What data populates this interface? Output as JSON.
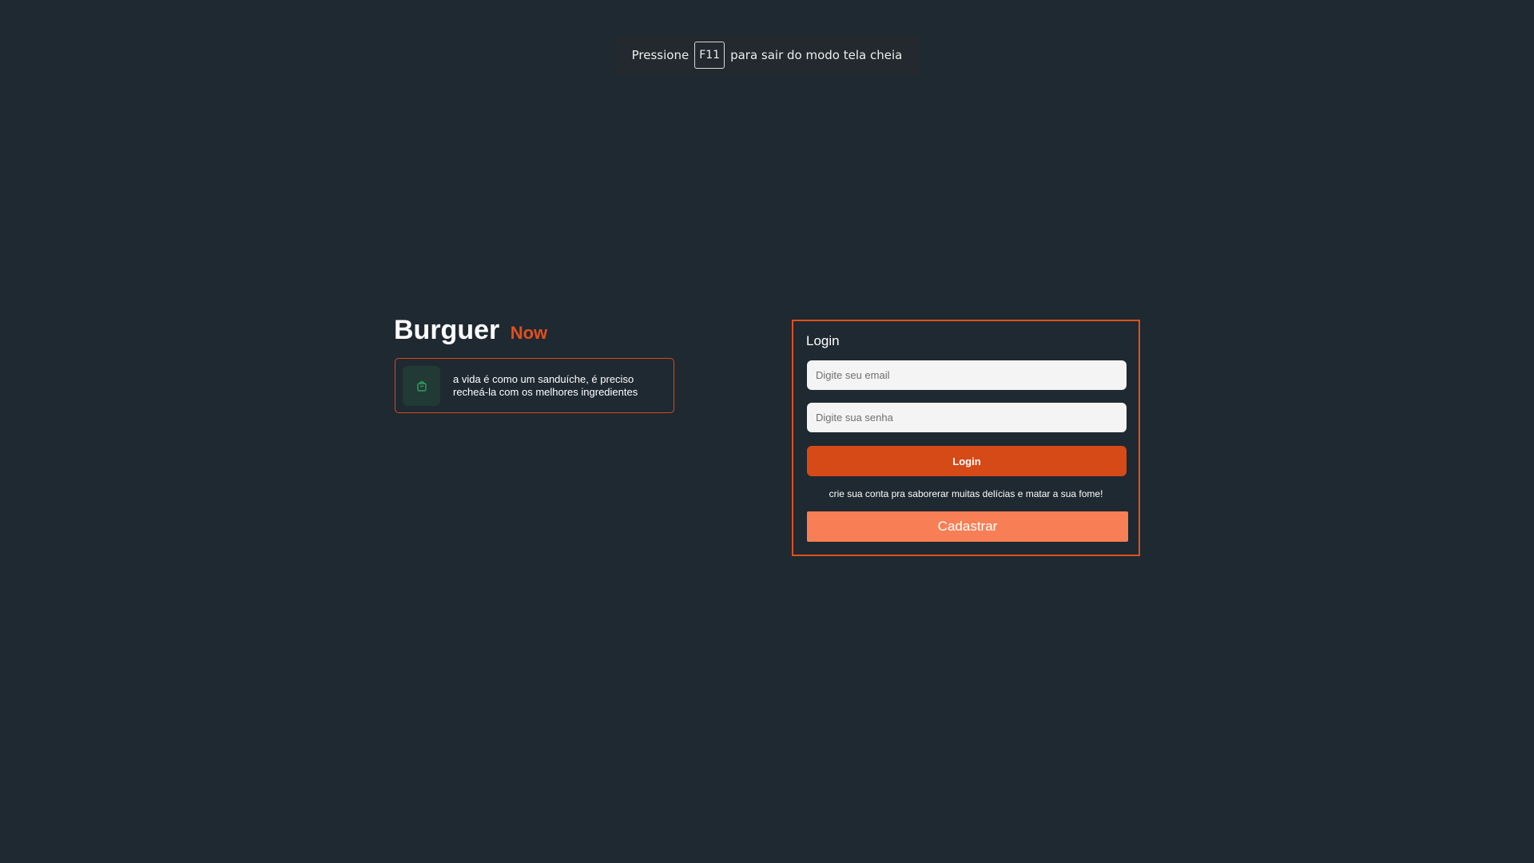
{
  "fullscreen_notice": {
    "prefix": "Pressione",
    "key": "F11",
    "suffix": "para sair do modo tela cheia"
  },
  "brand": {
    "name": "Burguer",
    "accent": "Now"
  },
  "tagline": {
    "icon": "shopping-bag-icon",
    "text": "a vida é como um sanduíche, é preciso recheá-la com os melhores ingredientes"
  },
  "login": {
    "title": "Login",
    "email_placeholder": "Digite seu email",
    "password_placeholder": "Digite sua senha",
    "login_button": "Login",
    "signup_prompt": "crie sua conta pra saborerar muitas delícias e matar a sua fome!",
    "signup_button": "Cadastrar"
  },
  "colors": {
    "background": "#1f2931",
    "accent": "#e0501f",
    "login_button": "#d64a18",
    "signup_button": "#f87f55",
    "icon_green": "#2ea05c"
  }
}
